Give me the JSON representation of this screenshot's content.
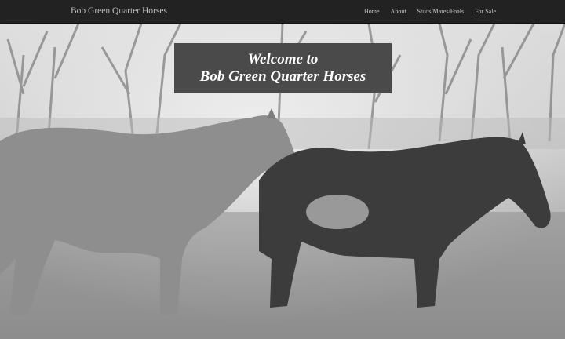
{
  "navbar": {
    "brand": "Bob Green Quarter Horses",
    "links": [
      {
        "label": "Home"
      },
      {
        "label": "About"
      },
      {
        "label": "Studs/Mares/Foals"
      },
      {
        "label": "For Sale"
      }
    ]
  },
  "hero": {
    "welcome_line1": "Welcome to",
    "welcome_line2": "Bob Green Quarter Horses"
  }
}
